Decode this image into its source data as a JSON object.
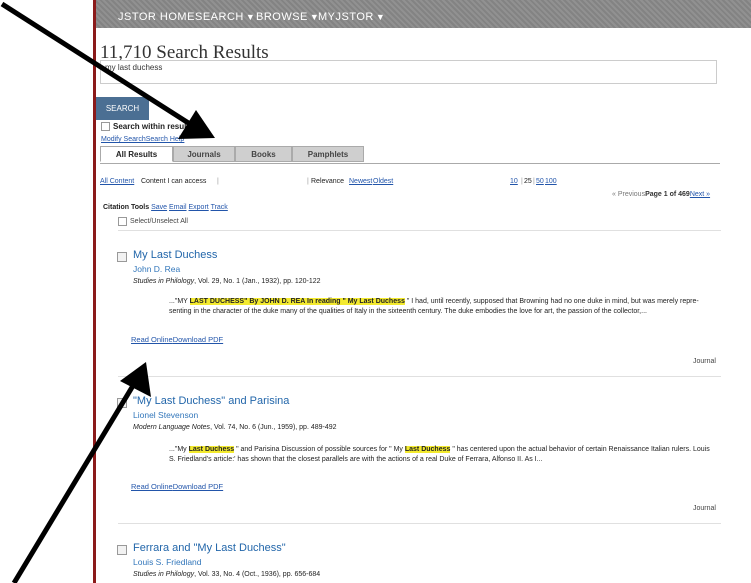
{
  "nav": {
    "home": "JSTOR HOME",
    "search": "SEARCH",
    "browse": "BROWSE",
    "myjstor": "MYJSTOR"
  },
  "results_title": "11,710 Search Results",
  "search": {
    "query": "my last duchess",
    "button": "SEARCH",
    "within": "Search within results",
    "modify": "Modify Search",
    "help": "Search Help"
  },
  "tabs": [
    "All Results",
    "Journals",
    "Books",
    "Pamphlets"
  ],
  "filters": {
    "all_content": "All Content",
    "content_access": "Content I can access",
    "relevance": "Relevance",
    "newest": "Newest",
    "oldest": "Oldest",
    "per_page": [
      "10",
      "25",
      "50",
      "100"
    ],
    "per_page_selected": "25"
  },
  "pagination": {
    "previous": "« Previous",
    "page": "Page 1 of 469",
    "next": "Next »"
  },
  "citation_tools": {
    "label": "Citation Tools",
    "save": "Save",
    "email": "Email",
    "export": "Export",
    "track": "Track"
  },
  "select_all": "Select/Unselect All",
  "results": [
    {
      "title": "My Last Duchess",
      "author": "John D. Rea",
      "journal": "Studies in Philology",
      "citation": ", Vol. 29, No. 1 (Jan., 1932), pp. 120-122",
      "snippet_pre": "...\"MY ",
      "hl1": "LAST DUCHESS\" By JOHN D. REA In reading \" My Last Duchess",
      "snippet_post": " \" I had, until recently, supposed that Browning had no one duke in mind, but was merely repre- senting in the character of the duke many of the qualities of Italy in the sixteenth century. The duke embodies the love for art, the passion of the collector,...",
      "read_online": "Read Online",
      "download": "Download PDF",
      "type": "Journal"
    },
    {
      "title": "\"My Last Duchess\" and Parisina",
      "author": "Lionel Stevenson",
      "journal": "Modern Language Notes",
      "citation": ", Vol. 74, No. 6 (Jun., 1959), pp. 489-492",
      "snippet_pre": "...\"My ",
      "hl1": "Last Duchess",
      "snippet_mid": " \" and Parisina Discussion of possible sources for \" My ",
      "hl2": "Last Duchess",
      "snippet_post": " \" has centered upon the actual behavior of certain Renaissance Italian rulers. Louis S. Friedland's article:' has shown that the closest parallels are with the actions of a real Duke of Ferrara, Alfonso II. As I...",
      "read_online": "Read Online",
      "download": "Download PDF",
      "type": "Journal"
    },
    {
      "title": "Ferrara and \"My Last Duchess\"",
      "author": "Louis S. Friedland",
      "journal": "Studies in Philology",
      "citation": ", Vol. 33, No. 4 (Oct., 1936), pp. 656-684"
    }
  ],
  "colors": {
    "nav_bg": "#8a8a8a",
    "accent_bar": "#8b1a1a",
    "search_button": "#4b6f93",
    "link": "#2255aa",
    "highlight": "#f3ea2f"
  }
}
